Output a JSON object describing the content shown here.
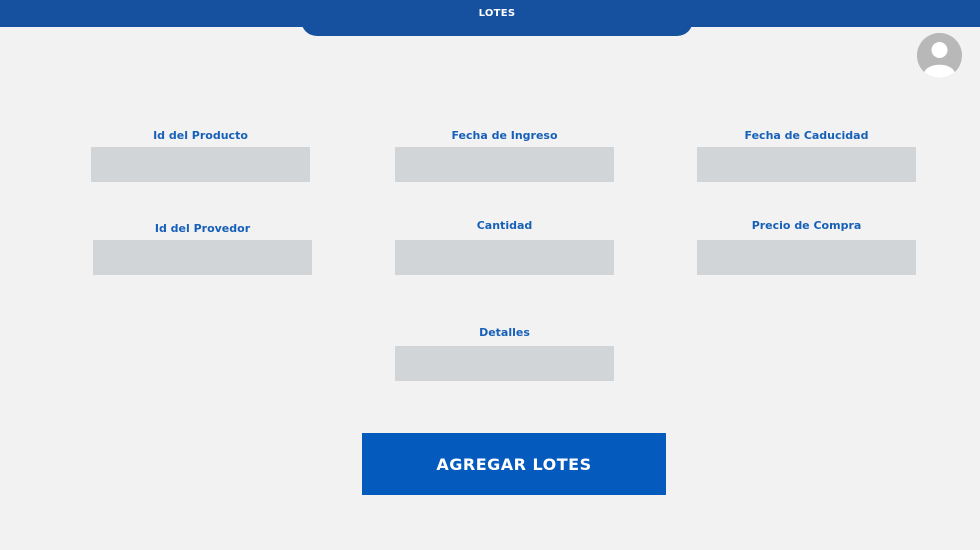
{
  "header": {
    "title": "LOTES"
  },
  "form": {
    "fields": [
      {
        "label": "Id del Producto",
        "value": ""
      },
      {
        "label": "Fecha de Ingreso",
        "value": ""
      },
      {
        "label": "Fecha de Caducidad",
        "value": ""
      },
      {
        "label": "Id del Provedor",
        "value": ""
      },
      {
        "label": "Cantidad",
        "value": ""
      },
      {
        "label": "Precio de Compra",
        "value": ""
      },
      {
        "label": "Detalles",
        "value": ""
      }
    ],
    "submit_label": "AGREGAR LOTES"
  },
  "icons": {
    "avatar": "user-avatar-icon"
  },
  "colors": {
    "header": "#1651a0",
    "label": "#1760b8",
    "input_bg": "#d1d5d8",
    "button": "#055bbd",
    "background": "#f2f2f2"
  }
}
